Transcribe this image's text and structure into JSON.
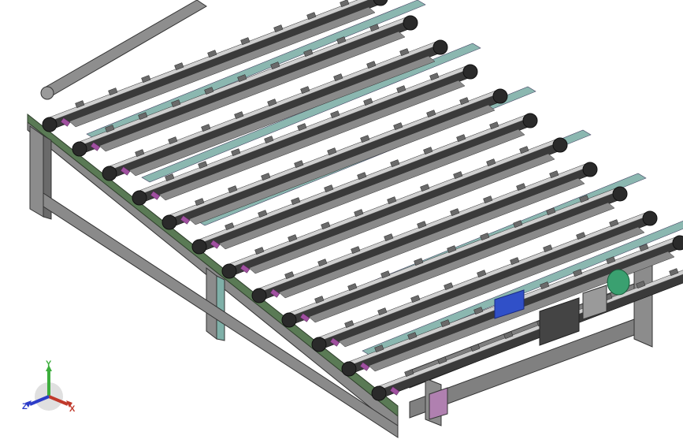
{
  "viewport": {
    "background": "#ffffff"
  },
  "model": {
    "frame_color": "#7f7f7f",
    "frame_dark": "#4a4a4a",
    "rail_color": "#5a7a55",
    "chain_color": "#3a3a3a",
    "link_color": "#cfcfcf",
    "roller_color": "#8a8a8a",
    "accent_pink": "#a050a0",
    "accent_teal": "#7fb0a8",
    "motor_green": "#3aa070",
    "gear_blue": "#3050c8",
    "conveyor_count": 12
  },
  "triad": {
    "x_label": "X",
    "y_label": "Y",
    "z_label": "Z",
    "x_color": "#c0392b",
    "y_color": "#3cae3c",
    "z_color": "#2c3cc8"
  }
}
